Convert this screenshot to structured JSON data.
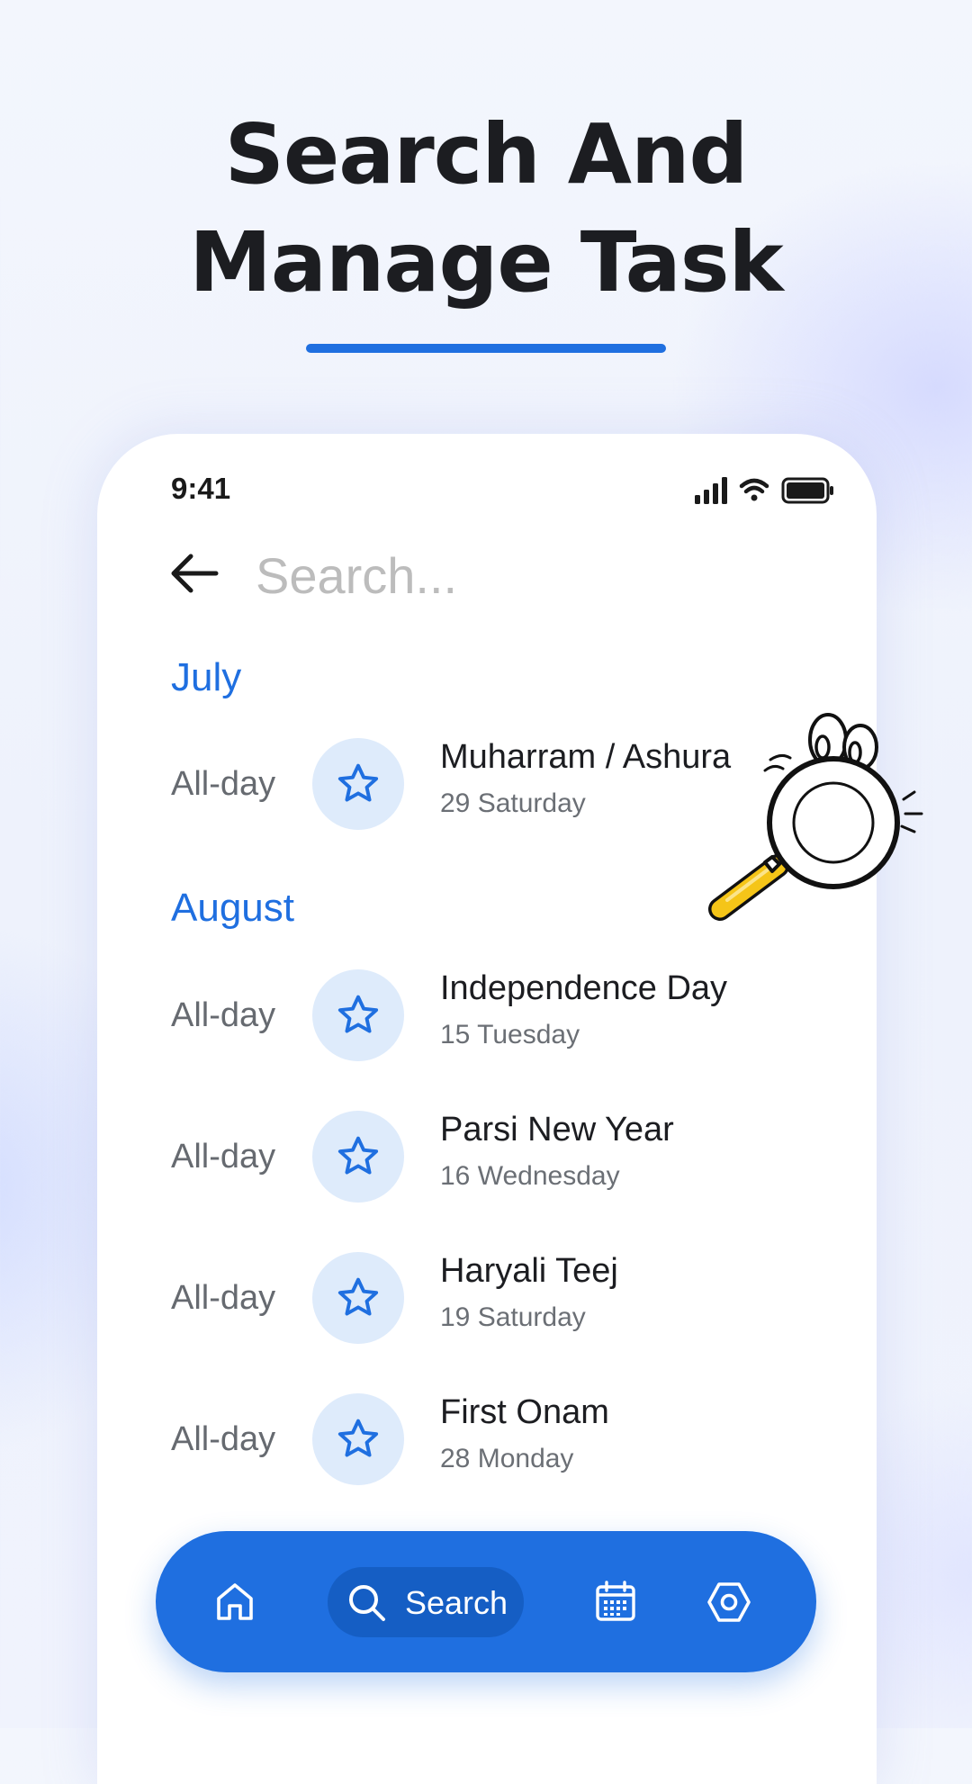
{
  "headline": {
    "line1": "Search And",
    "line2": "Manage Task"
  },
  "status_bar": {
    "time": "9:41"
  },
  "search": {
    "placeholder": "Search..."
  },
  "months": [
    {
      "name": "July",
      "events": [
        {
          "time": "All-day",
          "title": "Muharram / Ashura",
          "date": "29 Saturday",
          "icon": "star-icon"
        }
      ]
    },
    {
      "name": "August",
      "events": [
        {
          "time": "All-day",
          "title": "Independence Day",
          "date": "15 Tuesday",
          "icon": "star-icon"
        },
        {
          "time": "All-day",
          "title": "Parsi New Year",
          "date": "16 Wednesday",
          "icon": "star-icon"
        },
        {
          "time": "All-day",
          "title": "Haryali Teej",
          "date": "19 Saturday",
          "icon": "star-icon"
        },
        {
          "time": "All-day",
          "title": "First Onam",
          "date": "28 Monday",
          "icon": "star-icon"
        }
      ]
    }
  ],
  "bottom_nav": {
    "items": [
      {
        "icon": "home-icon",
        "label": ""
      },
      {
        "icon": "search-icon",
        "label": "Search",
        "active": true
      },
      {
        "icon": "calendar-icon",
        "label": ""
      },
      {
        "icon": "settings-icon",
        "label": ""
      }
    ]
  },
  "colors": {
    "accent": "#1f6fe0",
    "badge_bg": "#deebfb",
    "nav_active": "#155ec4",
    "magnifier_handle": "#f5c518"
  }
}
